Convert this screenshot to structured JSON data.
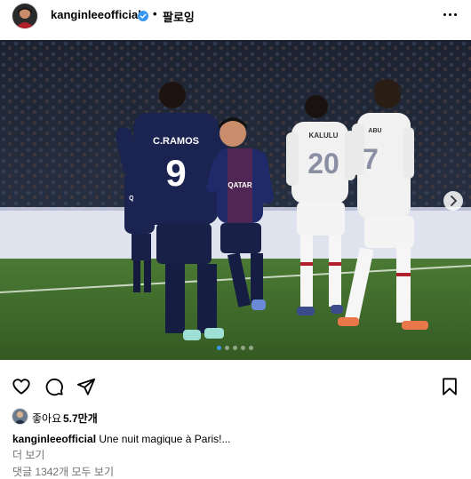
{
  "header": {
    "username": "kanginleeofficial",
    "separator": "•",
    "follow_label": "팔로잉"
  },
  "icons": {
    "verified": "verified-badge-icon",
    "more": "more-options-icon",
    "like": "heart-icon",
    "comment": "comment-icon",
    "share": "send-icon",
    "save": "bookmark-icon",
    "next": "chevron-right-icon"
  },
  "photo": {
    "players": [
      {
        "name": "C.RAMOS",
        "number": "9"
      },
      {
        "name": "KALULU",
        "number": "20"
      },
      {
        "name": "ABU",
        "number": "7"
      }
    ],
    "sponsor": "QATAR",
    "carousel_total": 5,
    "carousel_active": 1
  },
  "likes": {
    "label": "좋아요",
    "count": "5.7만개"
  },
  "caption": {
    "username": "kanginleeofficial",
    "text": "Une nuit magique à Paris!..."
  },
  "more_label": "더 보기",
  "comments_label": "댓글 1342개 모두 보기",
  "colors": {
    "accent": "#3897f0",
    "secondary_text": "#737373",
    "psg_navy": "#1b2350",
    "milan_white": "#f1f1f1",
    "pitch": "#3f6a2c"
  }
}
